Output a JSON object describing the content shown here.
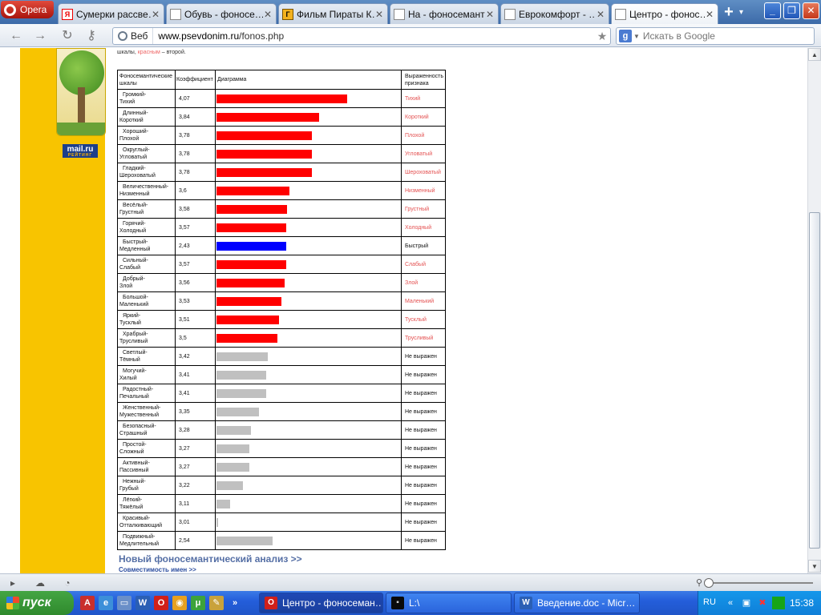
{
  "browser": {
    "menu_label": "Opera",
    "tabs": [
      {
        "title": "Сумерки рассве…",
        "icon": "yandex-icon",
        "active": false
      },
      {
        "title": "Обувь - фоносе…",
        "icon": "page-icon",
        "active": false
      },
      {
        "title": "Фильм Пираты К…",
        "icon": "kinopoisk-icon",
        "active": false
      },
      {
        "title": "На - фоносемант…",
        "icon": "page-icon",
        "active": false
      },
      {
        "title": "Еврокомфорт - …",
        "icon": "page-icon",
        "active": false
      },
      {
        "title": "Центро - фонос…",
        "icon": "page-icon",
        "active": true
      }
    ],
    "new_tab": "+",
    "address": {
      "mode_label": "Веб",
      "domain": "www.psevdonim.ru",
      "path": "/fonos.php"
    },
    "search_placeholder": "Искать в Google"
  },
  "page": {
    "intro_text_1": "шкалы, ",
    "intro_red": "красным",
    "intro_text_2": " – второй.",
    "logo_text": "mail.ru",
    "logo_sub": "РЕЙТИНГ",
    "table": {
      "headers": {
        "scale": "Фоносемантические шкалы",
        "coef": "Коэффициент",
        "chart": "Диаграмма",
        "result": "Выраженность признака"
      },
      "rows": [
        {
          "first": "Громкий-",
          "second": "Тихий",
          "coef": "4,07",
          "value": 4.07,
          "color": "#ff0000",
          "result": "Тихий",
          "result_red": true
        },
        {
          "first": "Длинный-",
          "second": "Короткий",
          "coef": "3,84",
          "value": 3.84,
          "color": "#ff0000",
          "result": "Короткий",
          "result_red": true
        },
        {
          "first": "Хороший-",
          "second": "Плохой",
          "coef": "3,78",
          "value": 3.78,
          "color": "#ff0000",
          "result": "Плохой",
          "result_red": true
        },
        {
          "first": "Округлый-",
          "second": "Угловатый",
          "coef": "3,78",
          "value": 3.78,
          "color": "#ff0000",
          "result": "Угловатый",
          "result_red": true
        },
        {
          "first": "Гладкий-",
          "second": "Шероховатый",
          "coef": "3,78",
          "value": 3.78,
          "color": "#ff0000",
          "result": "Шероховатый",
          "result_red": true
        },
        {
          "first": "Величественный-",
          "second": "Низменный",
          "coef": "3,6",
          "value": 3.6,
          "color": "#ff0000",
          "result": "Низменный",
          "result_red": true
        },
        {
          "first": "Весёлый-",
          "second": "Грустный",
          "coef": "3,58",
          "value": 3.58,
          "color": "#ff0000",
          "result": "Грустный",
          "result_red": true
        },
        {
          "first": "Горячий-",
          "second": "Холодный",
          "coef": "3,57",
          "value": 3.57,
          "color": "#ff0000",
          "result": "Холодный",
          "result_red": true
        },
        {
          "first": "Быстрый-",
          "second": "Медленный",
          "coef": "2,43",
          "value": 3.57,
          "color": "#0000ff",
          "result": "Быстрый",
          "result_red": false
        },
        {
          "first": "Сильный-",
          "second": "Слабый",
          "coef": "3,57",
          "value": 3.57,
          "color": "#ff0000",
          "result": "Слабый",
          "result_red": true
        },
        {
          "first": "Добрый-",
          "second": "Злой",
          "coef": "3,56",
          "value": 3.56,
          "color": "#ff0000",
          "result": "Злой",
          "result_red": true
        },
        {
          "first": "Большой-",
          "second": "Маленький",
          "coef": "3,53",
          "value": 3.53,
          "color": "#ff0000",
          "result": "Маленький",
          "result_red": true
        },
        {
          "first": "Яркий-",
          "second": "Тусклый",
          "coef": "3,51",
          "value": 3.51,
          "color": "#ff0000",
          "result": "Тусклый",
          "result_red": true
        },
        {
          "first": "Храбрый-",
          "second": "Трусливый",
          "coef": "3,5",
          "value": 3.5,
          "color": "#ff0000",
          "result": "Трусливый",
          "result_red": true
        },
        {
          "first": "Светлый-",
          "second": "Тёмный",
          "coef": "3,42",
          "value": 3.42,
          "color": "#c0c0c0",
          "result": "Не выражен",
          "result_red": false
        },
        {
          "first": "Могучий-",
          "second": "Хилый",
          "coef": "3,41",
          "value": 3.41,
          "color": "#c0c0c0",
          "result": "Не выражен",
          "result_red": false
        },
        {
          "first": "Радостный-",
          "second": "Печальный",
          "coef": "3,41",
          "value": 3.41,
          "color": "#c0c0c0",
          "result": "Не выражен",
          "result_red": false
        },
        {
          "first": "Женственный-",
          "second": "Мужественный",
          "coef": "3,35",
          "value": 3.35,
          "color": "#c0c0c0",
          "result": "Не выражен",
          "result_red": false
        },
        {
          "first": "Безопасный-",
          "second": "Страшный",
          "coef": "3,28",
          "value": 3.28,
          "color": "#c0c0c0",
          "result": "Не выражен",
          "result_red": false
        },
        {
          "first": "Простой-",
          "second": "Сложный",
          "coef": "3,27",
          "value": 3.27,
          "color": "#c0c0c0",
          "result": "Не выражен",
          "result_red": false
        },
        {
          "first": "Активный-",
          "second": "Пассивный",
          "coef": "3,27",
          "value": 3.27,
          "color": "#c0c0c0",
          "result": "Не выражен",
          "result_red": false
        },
        {
          "first": "Нежный-",
          "second": "Грубый",
          "coef": "3,22",
          "value": 3.22,
          "color": "#c0c0c0",
          "result": "Не выражен",
          "result_red": false
        },
        {
          "first": "Лёгкий-",
          "second": "Тяжёлый",
          "coef": "3,11",
          "value": 3.11,
          "color": "#c0c0c0",
          "result": "Не выражен",
          "result_red": false
        },
        {
          "first": "Красивый-",
          "second": "Отталкивающий",
          "coef": "3,01",
          "value": 3.01,
          "color": "#c0c0c0",
          "result": "Не выражен",
          "result_red": false
        },
        {
          "first": "Подвижный-",
          "second": "Медлительный",
          "coef": "2,54",
          "value": 3.46,
          "color": "#c0c0c0",
          "result": "Не выражен",
          "result_red": false
        }
      ]
    },
    "link_new_analysis": "Новый фоносемантический анализ >>",
    "link_compat": "Совместимость имен >>"
  },
  "taskbar": {
    "start_label": "пуск",
    "tasks": [
      {
        "title": "Центро - фоносеман…",
        "active": true
      },
      {
        "title": "L:\\",
        "active": false
      },
      {
        "title": "Введение.doc - Micr…",
        "active": false
      }
    ],
    "lang": "RU",
    "clock": "15:38"
  },
  "colors": {
    "side_panel": "#f8c400",
    "bar_red": "#ff0000",
    "bar_blue": "#0000ff",
    "bar_gray": "#c0c0c0",
    "result_red": "#e45252"
  }
}
